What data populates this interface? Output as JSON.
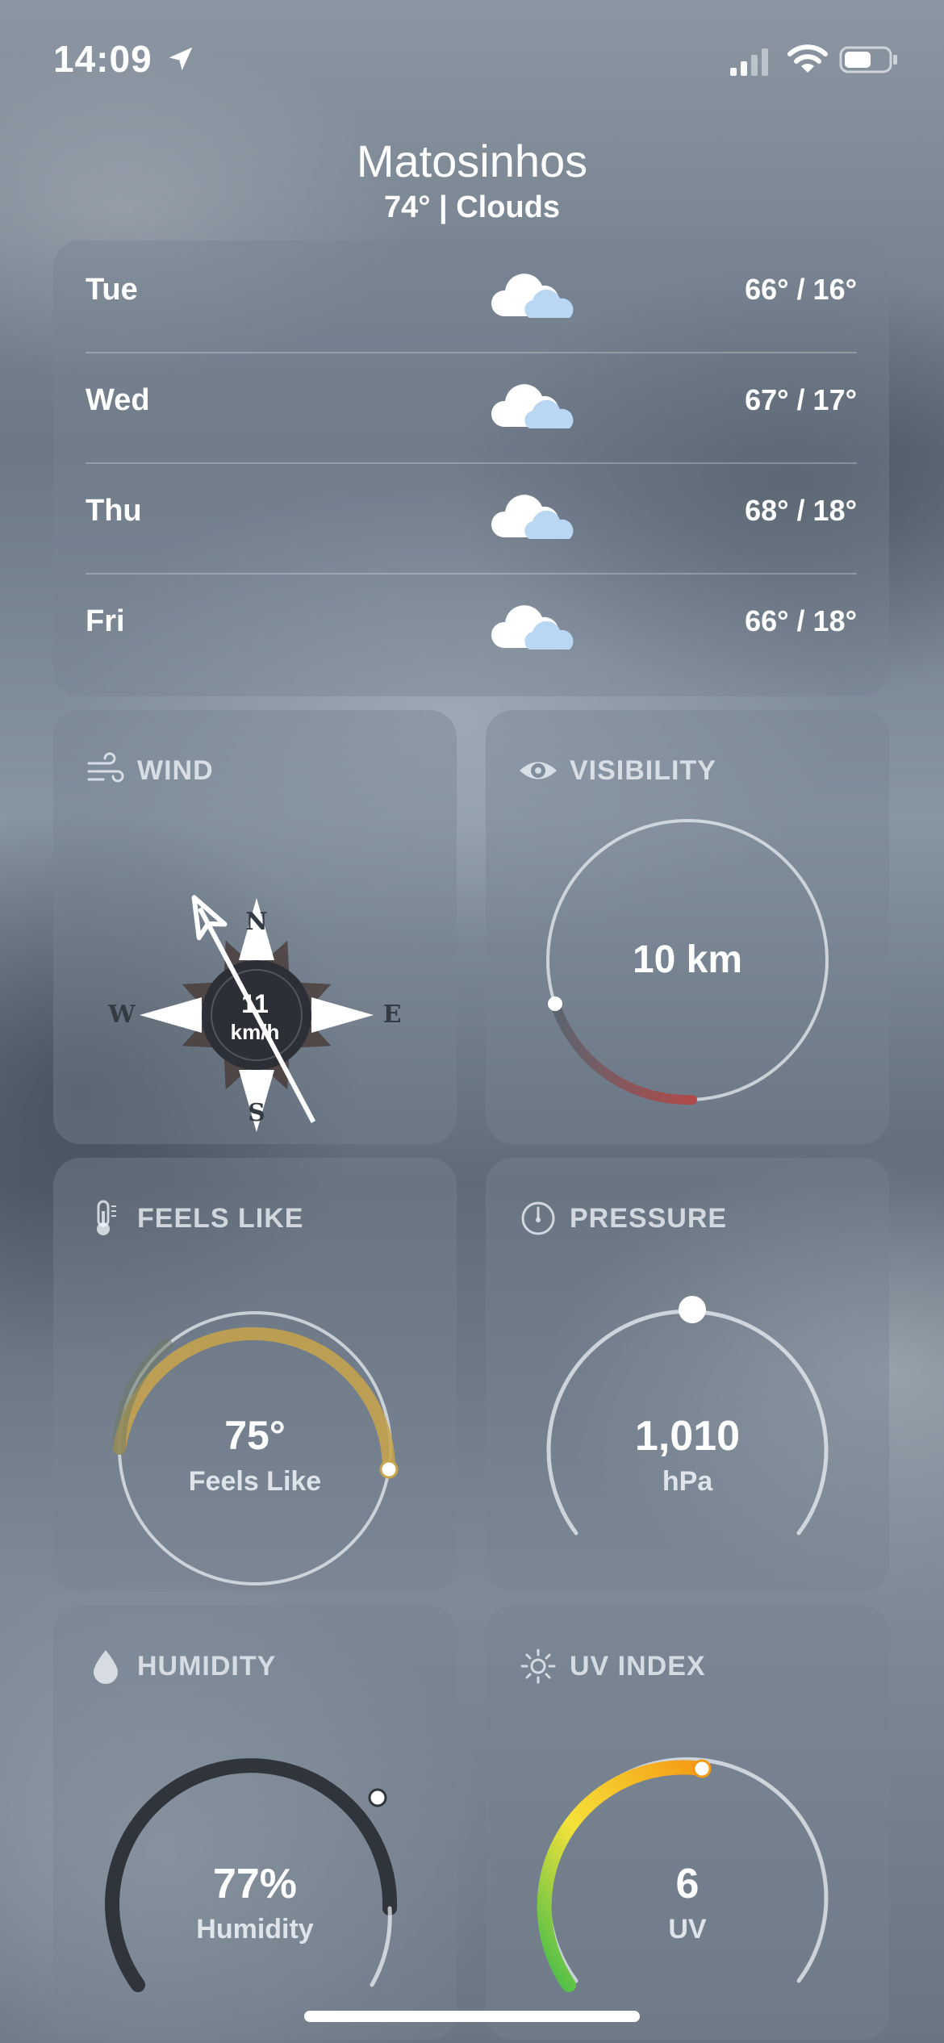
{
  "status_bar": {
    "time": "14:09"
  },
  "header": {
    "city": "Matosinhos",
    "conditions": "74° | Clouds"
  },
  "forecast": [
    {
      "day": "Tue",
      "temps": "66° / 16°",
      "icon": "cloud-icon"
    },
    {
      "day": "Wed",
      "temps": "67° / 17°",
      "icon": "cloud-icon"
    },
    {
      "day": "Thu",
      "temps": "68° / 18°",
      "icon": "cloud-icon"
    },
    {
      "day": "Fri",
      "temps": "66° / 18°",
      "icon": "cloud-icon"
    }
  ],
  "wind": {
    "label": "WIND",
    "speed": "11",
    "unit": "km/h",
    "directions": {
      "n": "N",
      "e": "E",
      "s": "S",
      "w": "W"
    },
    "arrow_bearing_deg": 152
  },
  "visibility": {
    "label": "VISIBILITY",
    "value": "10 km",
    "accent": "#b04a4a"
  },
  "feels_like": {
    "label": "FEELS LIKE",
    "value": "75°",
    "caption": "Feels Like",
    "accent": "#c9a54a"
  },
  "pressure": {
    "label": "PRESSURE",
    "value": "1,010",
    "unit": "hPa"
  },
  "humidity": {
    "label": "HUMIDITY",
    "value": "77%",
    "caption": "Humidity",
    "percent": 77
  },
  "uv_index": {
    "label": "UV INDEX",
    "value": "6",
    "caption": "UV",
    "colors": [
      "#3dbb4a",
      "#f5e23a",
      "#f59a14"
    ]
  }
}
